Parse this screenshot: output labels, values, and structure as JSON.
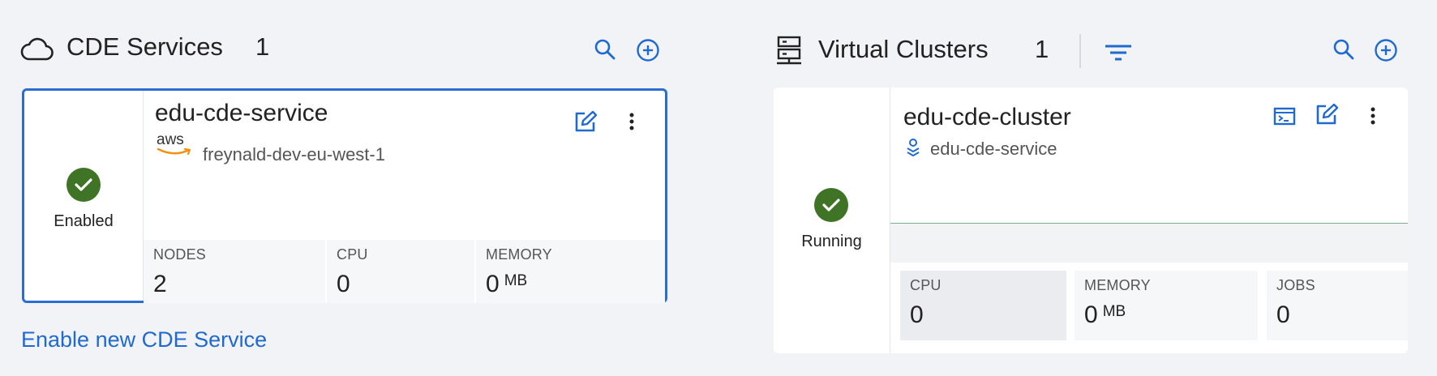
{
  "services": {
    "title": "CDE Services",
    "count": "1",
    "card": {
      "status": "Enabled",
      "name": "edu-cde-service",
      "provider_logo": "aws",
      "environment": "freynald-dev-eu-west-1",
      "metrics": [
        {
          "label": "NODES",
          "value": "2",
          "unit": ""
        },
        {
          "label": "CPU",
          "value": "0",
          "unit": ""
        },
        {
          "label": "MEMORY",
          "value": "0",
          "unit": "MB"
        }
      ]
    },
    "enable_link": "Enable new CDE Service"
  },
  "clusters": {
    "title": "Virtual Clusters",
    "count": "1",
    "card": {
      "status": "Running",
      "name": "edu-cde-cluster",
      "service": "edu-cde-service",
      "metrics": [
        {
          "label": "CPU",
          "value": "0",
          "unit": ""
        },
        {
          "label": "MEMORY",
          "value": "0",
          "unit": "MB"
        },
        {
          "label": "JOBS",
          "value": "0",
          "unit": ""
        }
      ]
    }
  },
  "colors": {
    "accent": "#1f6ad1",
    "status_ok": "#3f7326",
    "card_border": "#2a6ed0"
  },
  "icons": [
    "cloud-icon",
    "search-icon",
    "add-circle-icon",
    "edit-icon",
    "more-vert-icon",
    "check-icon",
    "server-icon",
    "filter-icon",
    "terminal-icon",
    "service-icon"
  ]
}
